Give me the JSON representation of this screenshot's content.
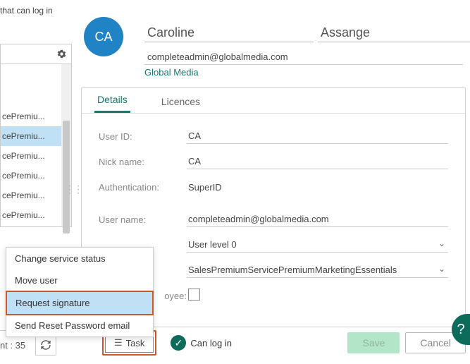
{
  "colors": {
    "accent": "#147a6c",
    "avatar": "#2083c5",
    "highlight": "#bfe0f5",
    "callout": "#c85a2a"
  },
  "left": {
    "header_text": "that can log in",
    "rows": [
      {
        "label": "cePremiu...",
        "selected": false
      },
      {
        "label": "cePremiu...",
        "selected": true
      },
      {
        "label": "cePremiu...",
        "selected": false
      },
      {
        "label": "cePremiu...",
        "selected": false
      },
      {
        "label": "cePremiu...",
        "selected": false
      },
      {
        "label": "cePremiu...",
        "selected": false
      }
    ]
  },
  "status": {
    "count_label": "nt : 35"
  },
  "user": {
    "initials": "CA",
    "first_name": "Caroline",
    "last_name": "Assange",
    "email": "completeadmin@globalmedia.com",
    "company": "Global Media"
  },
  "tabs": {
    "details": "Details",
    "licences": "Licences"
  },
  "form": {
    "user_id_label": "User ID:",
    "user_id_value": "CA",
    "nick_label": "Nick name:",
    "nick_value": "CA",
    "auth_label": "Authentication:",
    "auth_value": "SuperID",
    "username_label": "User name:",
    "username_value": "completeadmin@globalmedia.com",
    "userlevel_value": "User level 0",
    "plan_value": "SalesPremiumServicePremiumMarketingEssentials",
    "employee_label": "oyee:"
  },
  "footer": {
    "task_label": "Task",
    "can_log_in_label": "Can log in",
    "save_label": "Save",
    "cancel_label": "Cancel"
  },
  "menu": {
    "items": [
      {
        "label": "Change service status",
        "highlighted": false
      },
      {
        "label": "Move user",
        "highlighted": false
      },
      {
        "label": "Request signature",
        "highlighted": true
      },
      {
        "label": "Send Reset Password email",
        "highlighted": false
      }
    ]
  },
  "help": {
    "label": "?"
  }
}
